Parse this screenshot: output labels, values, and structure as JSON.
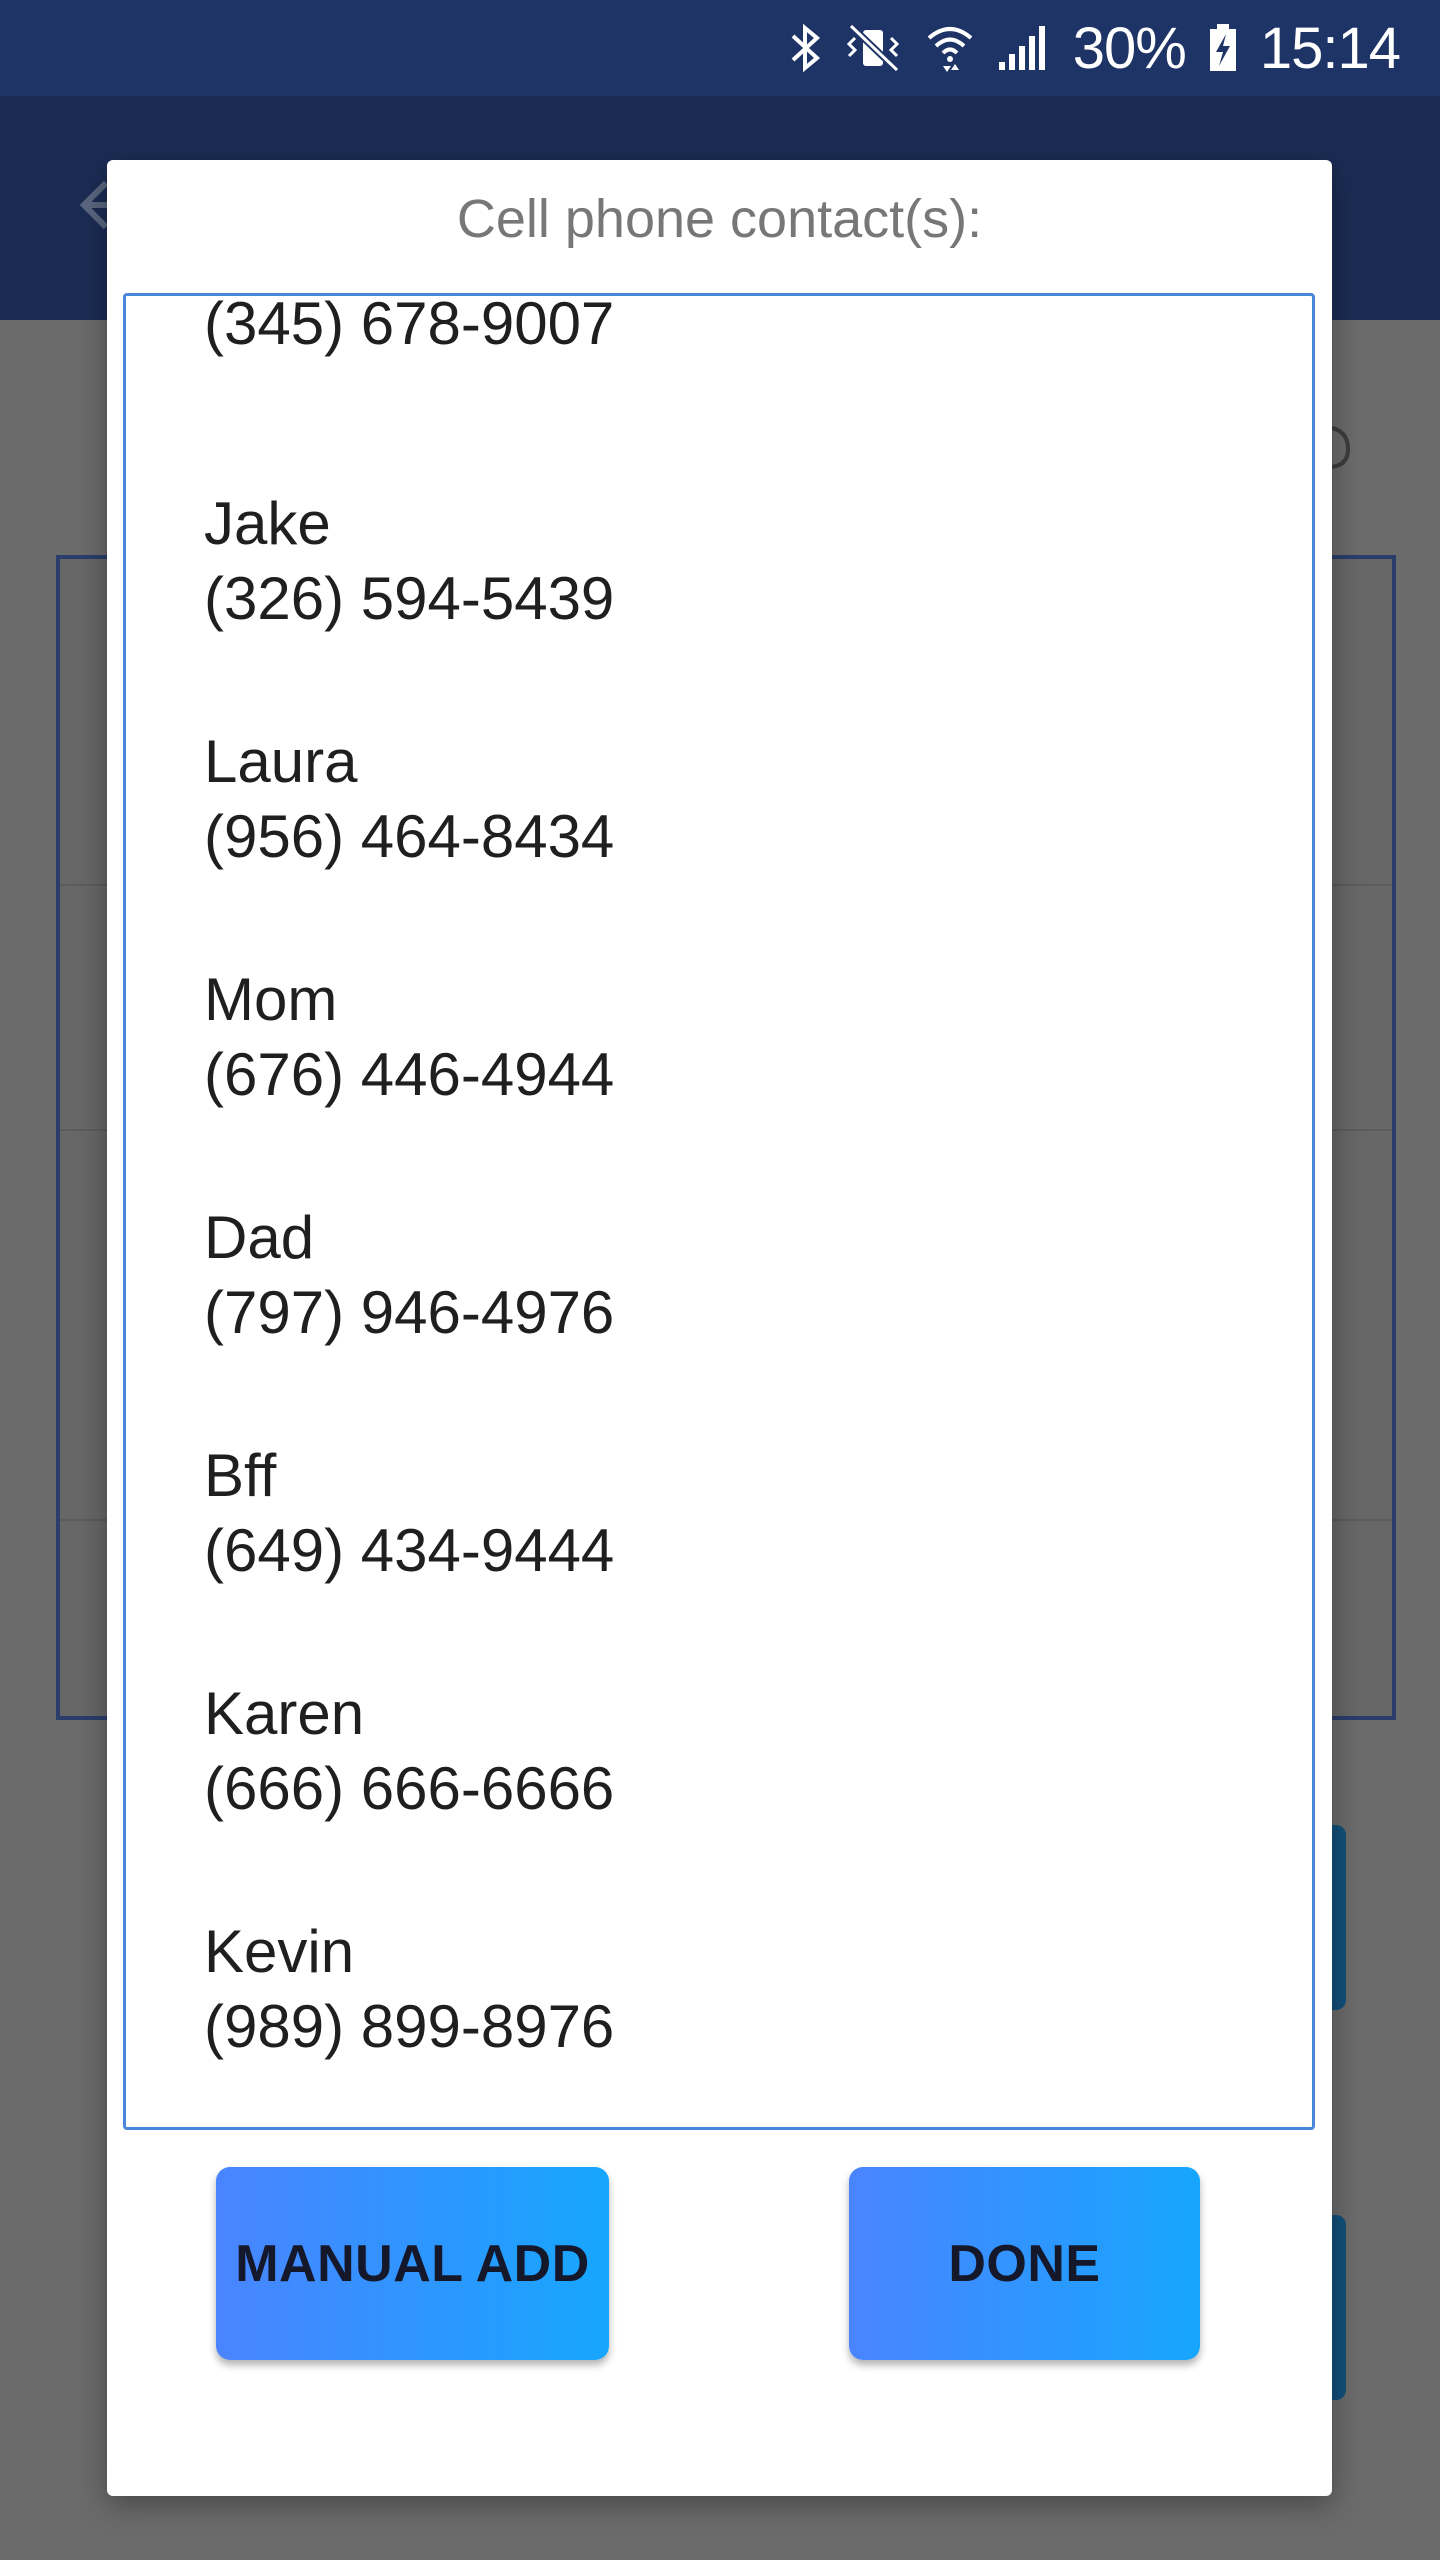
{
  "status_bar": {
    "battery": "30%",
    "time": "15:14",
    "icons": [
      "bluetooth-icon",
      "vibrate-mute-icon",
      "wifi-icon",
      "cell-signal-icon",
      "battery-charging-icon"
    ]
  },
  "dialog": {
    "title": "Cell phone contact(s):",
    "contacts": [
      {
        "name": "",
        "phone": "(345) 678-9007"
      },
      {
        "name": "Jake",
        "phone": "(326) 594-5439"
      },
      {
        "name": "Laura",
        "phone": "(956) 464-8434"
      },
      {
        "name": "Mom",
        "phone": "(676) 446-4944"
      },
      {
        "name": "Dad",
        "phone": "(797) 946-4976"
      },
      {
        "name": "Bff",
        "phone": "(649) 434-9444"
      },
      {
        "name": "Karen",
        "phone": "(666) 666-6666"
      },
      {
        "name": "Kevin",
        "phone": "(989) 899-8976"
      }
    ],
    "manual_add_label": "MANUAL ADD",
    "done_label": "DONE"
  },
  "colors": {
    "status_bar_bg": "#1f3466",
    "list_border": "#4a86d9",
    "button_gradient_start": "#4a84ff",
    "button_gradient_end": "#16a6ff",
    "scrim": "#6b6b6b"
  }
}
